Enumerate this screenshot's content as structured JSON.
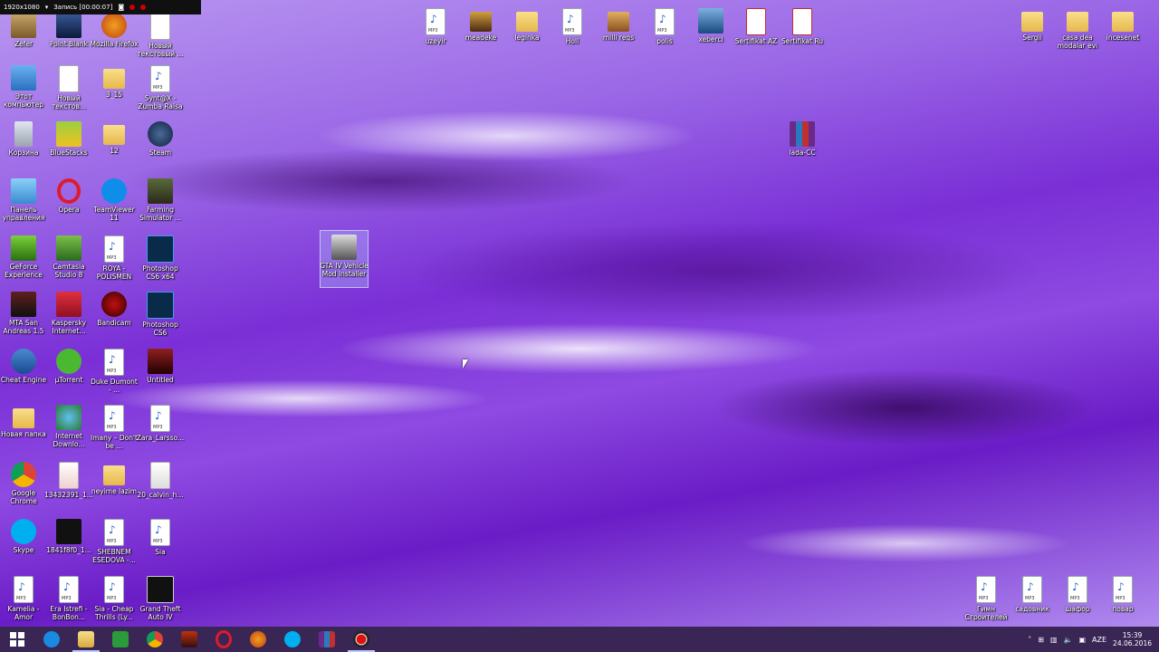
{
  "recorder": {
    "resolution": "1920x1080",
    "status": "Запись [00:00:07]"
  },
  "desktop_icons": {
    "zefer": "Zefer",
    "point_blank": "Point Blank",
    "firefox": "Mozilla Firefox",
    "new_text1": "Новый текстовый ...",
    "this_pc": "Этот компьютер",
    "new_text2": "Новый текстов...",
    "f3_15": "3_15",
    "synth": "Synt@X - Zumba Raisa",
    "recycle": "Корзина",
    "bluestacks": "BlueStacks",
    "f12": "12",
    "steam": "Steam",
    "control_panel": "Панель управления",
    "opera": "Opera",
    "teamviewer": "TeamViewer 11",
    "farming": "Farming Simulator ...",
    "geforce": "GeForce Experience",
    "camtasia": "Camtasia Studio 8",
    "roya": "ROYA - POLISMEN",
    "ps_x64": "Photoshop CS6 x64",
    "mta": "MTA San Andreas 1.5",
    "kaspersky": "Kaspersky Internet...",
    "bandicam": "Bandicam",
    "ps_cs6": "Photoshop CS6",
    "cheat_engine": "Cheat Engine",
    "utorrent": "µTorrent",
    "duke": "Duke Dumont - ...",
    "untitled": "Untitled",
    "new_folder": "Новая папка",
    "idm": "Internet Downlo...",
    "imany": "Imany – Don't be ...",
    "zara": "Zara_Larsso...",
    "chrome": "Google Chrome",
    "n13432391": "13432391_1...",
    "neyime": "neyime lazim",
    "calvin": "20_calvin_h...",
    "skype": "Skype",
    "f1841": "1841f8f0_1...",
    "sheb": "SHEBNEM ESEDOVA -...",
    "sia": "Sia",
    "kamelia": "Kamelia - Amor",
    "era_istrefi": "Era Istrefi - BonBon...",
    "sia_cheap": "Sia - Cheap Thrills (Ly...",
    "gta4": "Grand Theft Auto IV",
    "uzeyir": "uzeyir",
    "meadeke": "meadeke",
    "leginka": "leginka",
    "holl": "Holl",
    "milli": "milli reqs",
    "polis": "polis",
    "xeberci": "xeberci",
    "sert_az": "Sertifikat AZ",
    "sert_ru": "Sertifikat Ru",
    "sergii": "Sergii",
    "casa": "casa dea modalar evi",
    "incesenet": "incesenet",
    "lada": "lada-CC",
    "gta_vmi": "GTA IV Vehicle Mod Installer",
    "gimn": "Гимн Строителей",
    "sadovnik": "садовник",
    "shafor": "шафор",
    "povar": "повар"
  },
  "tray": {
    "lang": "AZE",
    "time": "15:39",
    "date": "24.06.2016"
  },
  "colors": {
    "taskbar": "#28144690",
    "accent": "#b9c9ff"
  }
}
